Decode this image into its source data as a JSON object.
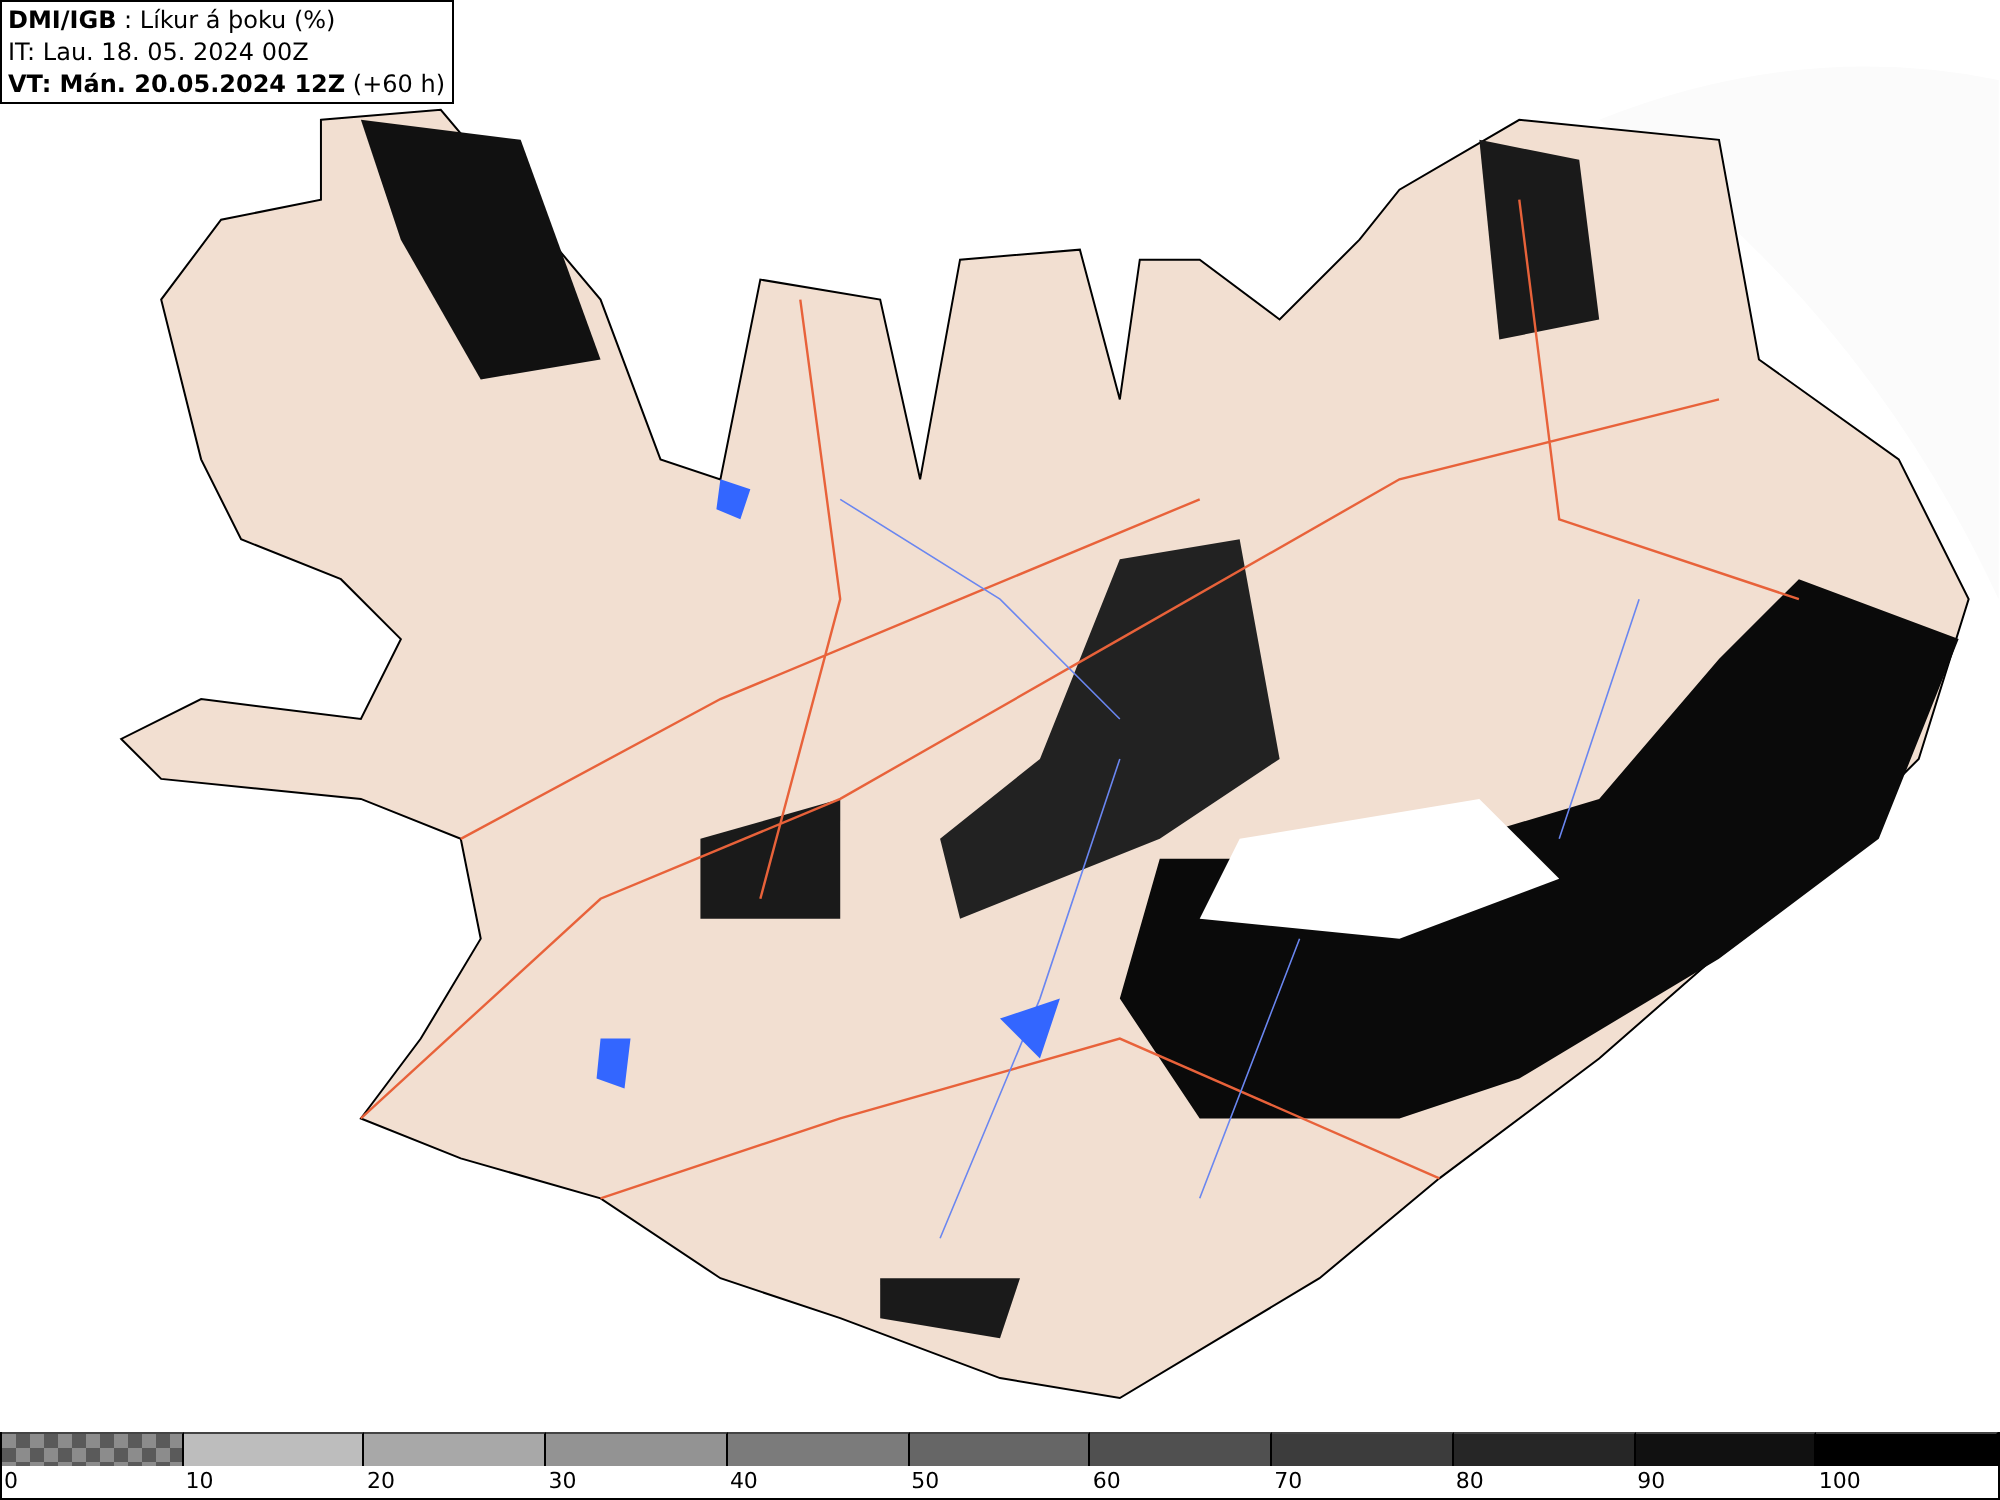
{
  "header": {
    "lines": [
      "**DMI/IGB** : Líkur á þoku (%)",
      "IT: Lau. 18. 05. 2024 00Z",
      "**VT: Mán. 20.05.2024 12Z** (+60 h)"
    ]
  },
  "legend": {
    "segments": [
      {
        "label": "0",
        "kind": "pattern",
        "color": "#5a5a5a"
      },
      {
        "label": "10",
        "kind": "solid",
        "color": "#bdbdbd"
      },
      {
        "label": "20",
        "kind": "solid",
        "color": "#a8a8a8"
      },
      {
        "label": "30",
        "kind": "solid",
        "color": "#939393"
      },
      {
        "label": "40",
        "kind": "solid",
        "color": "#7b7b7b"
      },
      {
        "label": "50",
        "kind": "solid",
        "color": "#666666"
      },
      {
        "label": "60",
        "kind": "solid",
        "color": "#505050"
      },
      {
        "label": "70",
        "kind": "solid",
        "color": "#3c3c3c"
      },
      {
        "label": "80",
        "kind": "solid",
        "color": "#262626"
      },
      {
        "label": "90",
        "kind": "solid",
        "color": "#111111"
      },
      {
        "label": "100",
        "kind": "solid",
        "color": "#000000"
      }
    ]
  }
}
